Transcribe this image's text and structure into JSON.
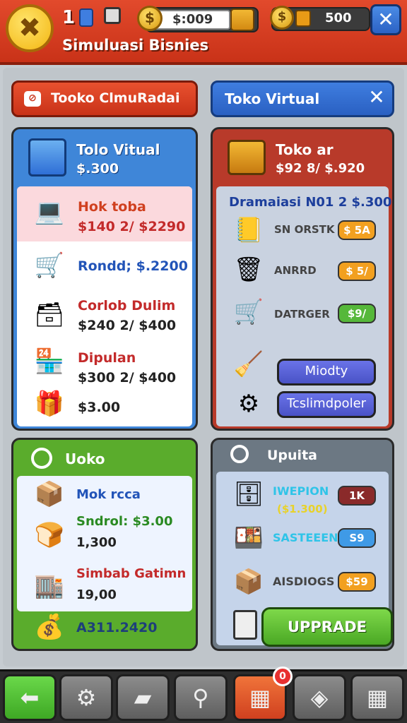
{
  "header": {
    "level": "1",
    "app_title": "Simuluasi Bisnies",
    "money_value": "$:009",
    "gems_value": "500",
    "logo_glyph": "✖",
    "close_glyph": "✕"
  },
  "tabs": {
    "left_label": "Tooko ClmuRadai",
    "right_label": "Toko Virtual",
    "right_close_glyph": "✕"
  },
  "panel_blue": {
    "title": "Tolo Vitual",
    "price": "$.300",
    "items": [
      {
        "name": "Hok toba",
        "price": "$140 2/ $2290",
        "icon": "laptop-icon"
      },
      {
        "name": "Rondd; $.2200",
        "price": "",
        "icon": "cart-icon"
      },
      {
        "name": "Corlob Dulim",
        "price": "$240 2/ $400",
        "icon": "register-icon"
      },
      {
        "name": "Dipulan",
        "price": "$300 2/ $400",
        "icon": "cashier-icon"
      },
      {
        "name": "",
        "price": "$3.00",
        "icon": "gift-icon"
      }
    ]
  },
  "panel_red": {
    "title": "Toko  ar",
    "price": "$92 8/ $.920",
    "subtitle": "Dramaiasi N01 2 $.300",
    "items": [
      {
        "label": "SN ORSTK",
        "badge": "$ 5A"
      },
      {
        "label": "ANRRD",
        "badge": "$ 5/"
      },
      {
        "label": "DATRGER",
        "badge": "$9/"
      }
    ],
    "btn1": "Miodty",
    "btn2": "Tcslimdpoler"
  },
  "panel_green": {
    "title": "Uoko",
    "items": [
      {
        "name": "Mok rcca",
        "price": ""
      },
      {
        "name": "Sndrol: $3.00",
        "price": "1,300"
      },
      {
        "name": "Simbab Gatimn",
        "price": "19,00"
      }
    ],
    "total": "A311.2420"
  },
  "panel_gray": {
    "title": "Upuita",
    "items": [
      {
        "label": "IWEPION",
        "sub": "($1.300)",
        "badge": "1K"
      },
      {
        "label": "SASTEEEN",
        "sub": "",
        "badge": "S9"
      },
      {
        "label": "AISDIOGS",
        "sub": "",
        "badge": "$59"
      }
    ],
    "upgrade": "UPPRADE"
  },
  "notification_count": "0",
  "colors": {
    "accent_red": "#d63a1e",
    "accent_blue": "#2f6fd6",
    "accent_green": "#5aac2c",
    "accent_gray": "#6c7883"
  }
}
